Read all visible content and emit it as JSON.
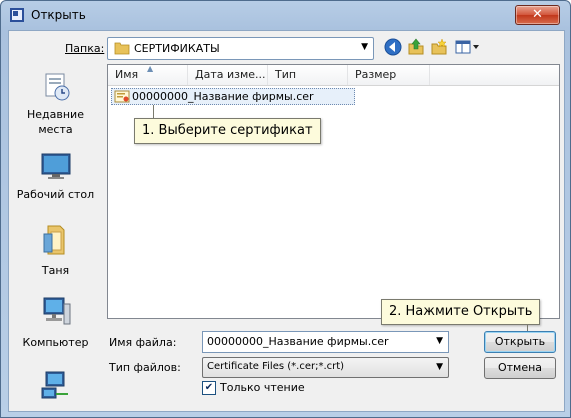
{
  "window": {
    "title": "Открыть",
    "close_label": "✕"
  },
  "toolbar": {
    "lookin_label": "Папка:",
    "lookin_value": "СЕРТИФИКАТЫ",
    "buttons": [
      "back-icon",
      "up-folder-icon",
      "new-folder-icon",
      "view-menu-icon"
    ]
  },
  "places": [
    {
      "label": "Недавние места",
      "icon": "recent-places-icon"
    },
    {
      "label": "Рабочий стол",
      "icon": "desktop-icon"
    },
    {
      "label": "Таня",
      "icon": "user-folder-icon"
    },
    {
      "label": "Компьютер",
      "icon": "computer-icon"
    },
    {
      "label": "",
      "icon": "network-icon"
    }
  ],
  "filelist": {
    "columns": [
      "Имя",
      "Дата изме...",
      "Тип",
      "Размер"
    ],
    "files": [
      {
        "name": "00000000_Название фирмы.cer",
        "icon": "certificate-icon",
        "selected": true
      }
    ]
  },
  "callouts": {
    "step1": "1. Выберите сертификат",
    "step2": "2. Нажмите Открыть"
  },
  "form": {
    "filename_label": "Имя файла:",
    "filename_value": "00000000_Название фирмы.cer",
    "filetype_label": "Тип файлов:",
    "filetype_value": "Certificate Files (*.cer;*.crt)",
    "readonly_label": "Только чтение",
    "readonly_checked": true
  },
  "buttons": {
    "open": "Открыть",
    "cancel": "Отмена"
  },
  "colors": {
    "title_bar": "#b7cde6",
    "close_button": "#c1371b",
    "callout_bg": "#fdfbdc"
  }
}
